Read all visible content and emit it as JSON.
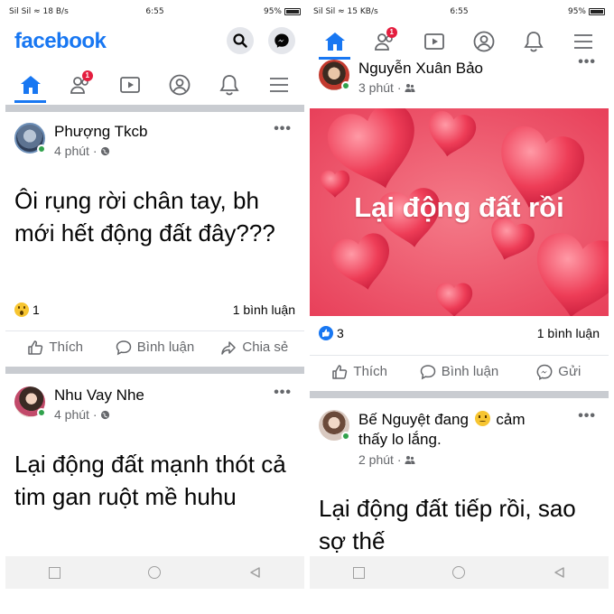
{
  "left": {
    "status": {
      "signal": "Sil Sil ≈ 18 B/s",
      "time": "6:55",
      "battery": "95%"
    },
    "header": {
      "logo": "facebook"
    },
    "nav": {
      "friends_badge": "1"
    },
    "posts": [
      {
        "author": "Phượng Tkcb",
        "time": "4 phút ·",
        "text": "Ôi rụng rời chân tay, bh mới hết động đất đây???",
        "reaction_count": "1",
        "comments": "1 bình luận",
        "actions": [
          "Thích",
          "Bình luận",
          "Chia sẻ"
        ]
      },
      {
        "author": "Nhu Vay Nhe",
        "time": "4 phút ·",
        "text": "Lại động đất mạnh thót cả tim gan ruột mề huhu"
      }
    ]
  },
  "right": {
    "status": {
      "signal": "Sil Sil ≈ 15 KB/s",
      "time": "6:55",
      "battery": "95%"
    },
    "nav": {
      "friends_badge": "1"
    },
    "posts": [
      {
        "author": "Nguyễn Xuân Bảo",
        "time": "3 phút ·",
        "image_caption": "Lại động đất rồi",
        "reaction_count": "3",
        "comments": "1 bình luận",
        "actions": [
          "Thích",
          "Bình luận",
          "Gửi"
        ]
      },
      {
        "author": "Bế Nguyệt",
        "status_line_1": "đang",
        "feeling": "cảm",
        "status_line_2": "thấy lo lắng.",
        "time": "2 phút ·",
        "text": "Lại động đất tiếp rồi, sao sợ thế"
      }
    ]
  },
  "colors": {
    "brand": "#1877f2",
    "separator": "#c9ccd1",
    "online": "#31a24c",
    "badge": "#e41e3f",
    "heart_bg": "#f05a6e"
  },
  "icons": [
    "home-icon",
    "friends-icon",
    "watch-icon",
    "profile-icon",
    "bell-icon",
    "menu-icon",
    "search-icon",
    "messenger-icon",
    "like-icon",
    "comment-icon",
    "share-icon",
    "send-icon",
    "globe-icon",
    "friends-audience-icon",
    "more-icon"
  ]
}
